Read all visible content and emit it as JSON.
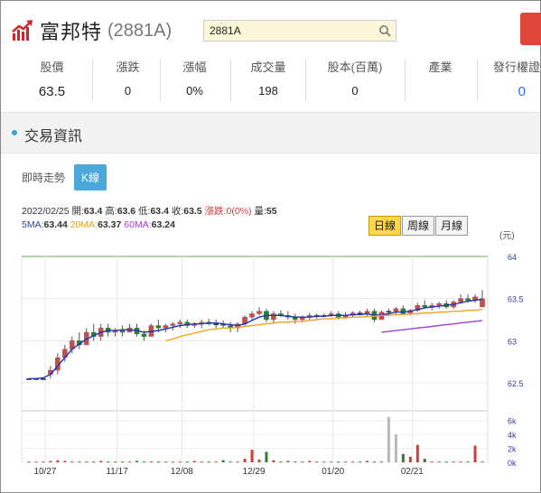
{
  "header": {
    "name": "富邦特",
    "code": "(2881A)"
  },
  "search": {
    "value": "2881A"
  },
  "stats": [
    {
      "label": "股價",
      "value": "63.5"
    },
    {
      "label": "漲跌",
      "value": "0"
    },
    {
      "label": "漲幅",
      "value": "0%"
    },
    {
      "label": "成交量",
      "value": "198"
    },
    {
      "label": "股本(百萬)",
      "value": "0"
    },
    {
      "label": "產業",
      "value": ""
    },
    {
      "label": "發行權證",
      "value": "0"
    }
  ],
  "section": {
    "title": "交易資訊"
  },
  "tabs": {
    "realtime": "即時走勢",
    "kline": "K線"
  },
  "quote": {
    "date": "2022/02/25",
    "open_label": "開:",
    "open": "63.4",
    "high_label": "高:",
    "high": "63.6",
    "low_label": "低:",
    "low": "63.4",
    "close_label": "收:",
    "close": "63.5",
    "change_label": "漲跌:",
    "change": "0(0%)",
    "volume_label": "量:",
    "volume": "55",
    "ma5_label": "5MA:",
    "ma5": "63.44",
    "ma20_label": "20MA:",
    "ma20": "63.37",
    "ma60_label": "60MA:",
    "ma60": "63.24"
  },
  "periods": {
    "day": "日線",
    "week": "周線",
    "month": "月線"
  },
  "chart_data": {
    "type": "candlestick",
    "unit": "(元)",
    "ylim": [
      62.2,
      64.0
    ],
    "price_ticks": [
      "64",
      "63.5",
      "63",
      "62.5"
    ],
    "volume_ticks": [
      "6k",
      "4k",
      "2k",
      "0k"
    ],
    "x_labels": [
      "10/27",
      "11/17",
      "12/08",
      "12/29",
      "01/20",
      "02/21"
    ],
    "candles": [
      [
        62.55,
        62.55,
        62.55,
        62.55
      ],
      [
        62.55,
        62.55,
        62.55,
        62.55
      ],
      [
        62.55,
        62.55,
        62.55,
        62.55
      ],
      [
        62.6,
        62.7,
        62.55,
        62.65
      ],
      [
        62.65,
        62.85,
        62.6,
        62.8
      ],
      [
        62.8,
        62.95,
        62.75,
        62.9
      ],
      [
        62.9,
        63.05,
        62.85,
        63.0
      ],
      [
        63.0,
        63.1,
        62.9,
        62.95
      ],
      [
        62.95,
        63.15,
        62.95,
        63.1
      ],
      [
        63.1,
        63.2,
        63.0,
        63.05
      ],
      [
        63.05,
        63.2,
        63.0,
        63.15
      ],
      [
        63.15,
        63.2,
        63.05,
        63.1
      ],
      [
        63.1,
        63.15,
        63.05,
        63.12
      ],
      [
        63.12,
        63.18,
        63.05,
        63.1
      ],
      [
        63.1,
        63.2,
        63.1,
        63.15
      ],
      [
        63.15,
        63.2,
        63.05,
        63.08
      ],
      [
        63.08,
        63.12,
        63.0,
        63.05
      ],
      [
        63.05,
        63.2,
        63.05,
        63.18
      ],
      [
        63.18,
        63.25,
        63.1,
        63.15
      ],
      [
        63.15,
        63.2,
        63.1,
        63.18
      ],
      [
        63.18,
        63.22,
        63.12,
        63.2
      ],
      [
        63.2,
        63.25,
        63.15,
        63.22
      ],
      [
        63.22,
        63.25,
        63.15,
        63.18
      ],
      [
        63.18,
        63.22,
        63.15,
        63.2
      ],
      [
        63.2,
        63.25,
        63.15,
        63.22
      ],
      [
        63.22,
        63.26,
        63.18,
        63.2
      ],
      [
        63.2,
        63.25,
        63.15,
        63.2
      ],
      [
        63.2,
        63.24,
        63.15,
        63.18
      ],
      [
        63.18,
        63.22,
        63.1,
        63.15
      ],
      [
        63.15,
        63.22,
        63.1,
        63.2
      ],
      [
        63.2,
        63.3,
        63.18,
        63.28
      ],
      [
        63.28,
        63.35,
        63.25,
        63.32
      ],
      [
        63.32,
        63.4,
        63.3,
        63.35
      ],
      [
        63.35,
        63.38,
        63.22,
        63.25
      ],
      [
        63.25,
        63.35,
        63.2,
        63.32
      ],
      [
        63.32,
        63.36,
        63.28,
        63.3
      ],
      [
        63.3,
        63.35,
        63.25,
        63.28
      ],
      [
        63.28,
        63.32,
        63.2,
        63.25
      ],
      [
        63.25,
        63.3,
        63.22,
        63.28
      ],
      [
        63.28,
        63.33,
        63.25,
        63.3
      ],
      [
        63.3,
        63.32,
        63.26,
        63.3
      ],
      [
        63.3,
        63.32,
        63.28,
        63.3
      ],
      [
        63.3,
        63.35,
        63.28,
        63.32
      ],
      [
        63.32,
        63.35,
        63.25,
        63.28
      ],
      [
        63.28,
        63.34,
        63.26,
        63.3
      ],
      [
        63.3,
        63.35,
        63.28,
        63.33
      ],
      [
        63.33,
        63.36,
        63.3,
        63.32
      ],
      [
        63.32,
        63.38,
        63.28,
        63.35
      ],
      [
        63.35,
        63.38,
        63.22,
        63.25
      ],
      [
        63.25,
        63.36,
        63.25,
        63.34
      ],
      [
        63.34,
        63.38,
        63.3,
        63.35
      ],
      [
        63.35,
        63.4,
        63.3,
        63.38
      ],
      [
        63.38,
        63.42,
        63.3,
        63.32
      ],
      [
        63.32,
        63.38,
        63.3,
        63.36
      ],
      [
        63.36,
        63.45,
        63.34,
        63.42
      ],
      [
        63.42,
        63.48,
        63.38,
        63.4
      ],
      [
        63.4,
        63.45,
        63.36,
        63.42
      ],
      [
        63.42,
        63.46,
        63.38,
        63.44
      ],
      [
        63.44,
        63.48,
        63.38,
        63.4
      ],
      [
        63.4,
        63.48,
        63.38,
        63.46
      ],
      [
        63.46,
        63.55,
        63.44,
        63.5
      ],
      [
        63.5,
        63.55,
        63.45,
        63.48
      ],
      [
        63.48,
        63.55,
        63.45,
        63.52
      ],
      [
        63.4,
        63.6,
        63.4,
        63.5
      ]
    ],
    "volumes": [
      0.1,
      0.1,
      0.1,
      0.2,
      0.3,
      0.2,
      0.1,
      0.1,
      0.1,
      0.1,
      0.2,
      0.1,
      0.1,
      0.1,
      0.1,
      0.2,
      0.1,
      0.1,
      0.1,
      0.1,
      0.1,
      0.1,
      0.1,
      0.2,
      0.1,
      0.1,
      0.1,
      0.3,
      0.1,
      0.1,
      0.5,
      1.8,
      0.4,
      1.5,
      0.3,
      0.1,
      0.2,
      0.1,
      0.1,
      0.2,
      0.1,
      0.1,
      0.1,
      0.1,
      0.1,
      0.1,
      0.1,
      0.2,
      0.1,
      0.1,
      6.5,
      4.0,
      1.2,
      0.8,
      2.5,
      0.5,
      0.1,
      0.1,
      0.1,
      0.1,
      0.1,
      0.1,
      2.4,
      0.1
    ],
    "series": [
      {
        "name": "5MA",
        "color": "#1f34b8",
        "values": [
          62.55,
          62.55,
          62.56,
          62.6,
          62.7,
          62.8,
          62.9,
          62.96,
          63.02,
          63.06,
          63.1,
          63.12,
          63.12,
          63.13,
          63.13,
          63.12,
          63.1,
          63.11,
          63.12,
          63.14,
          63.16,
          63.18,
          63.19,
          63.2,
          63.2,
          63.21,
          63.21,
          63.2,
          63.19,
          63.18,
          63.2,
          63.24,
          63.28,
          63.3,
          63.3,
          63.3,
          63.29,
          63.28,
          63.28,
          63.28,
          63.29,
          63.29,
          63.3,
          63.3,
          63.3,
          63.31,
          63.31,
          63.32,
          63.3,
          63.31,
          63.32,
          63.34,
          63.34,
          63.35,
          63.37,
          63.39,
          63.4,
          63.41,
          63.42,
          63.43,
          63.45,
          63.47,
          63.48,
          63.49
        ]
      },
      {
        "name": "20MA",
        "color": "#f0a42c",
        "values": [
          null,
          null,
          null,
          null,
          null,
          null,
          null,
          null,
          null,
          null,
          null,
          null,
          null,
          null,
          null,
          null,
          null,
          null,
          null,
          63.0,
          63.02,
          63.05,
          63.07,
          63.09,
          63.11,
          63.13,
          63.14,
          63.15,
          63.15,
          63.16,
          63.17,
          63.18,
          63.19,
          63.2,
          63.21,
          63.22,
          63.22,
          63.23,
          63.23,
          63.24,
          63.25,
          63.26,
          63.26,
          63.27,
          63.27,
          63.28,
          63.28,
          63.29,
          63.29,
          63.3,
          63.3,
          63.31,
          63.31,
          63.32,
          63.32,
          63.33,
          63.33,
          63.34,
          63.34,
          63.35,
          63.35,
          63.36,
          63.36,
          63.37
        ]
      },
      {
        "name": "60MA",
        "color": "#a53fd0",
        "values": [
          null,
          null,
          null,
          null,
          null,
          null,
          null,
          null,
          null,
          null,
          null,
          null,
          null,
          null,
          null,
          null,
          null,
          null,
          null,
          null,
          null,
          null,
          null,
          null,
          null,
          null,
          null,
          null,
          null,
          null,
          null,
          null,
          null,
          null,
          null,
          null,
          null,
          null,
          null,
          null,
          null,
          null,
          null,
          null,
          null,
          null,
          null,
          null,
          null,
          63.1,
          63.11,
          63.12,
          63.13,
          63.14,
          63.15,
          63.16,
          63.17,
          63.18,
          63.19,
          63.2,
          63.21,
          63.22,
          63.23,
          63.24
        ]
      }
    ]
  }
}
